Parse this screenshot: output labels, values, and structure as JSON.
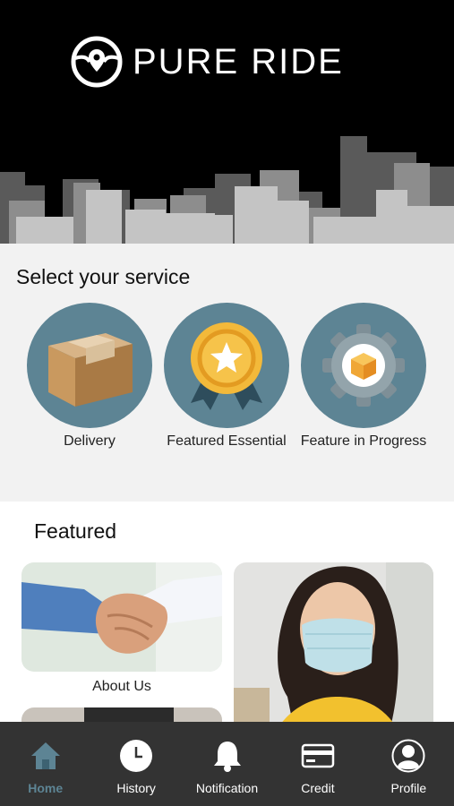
{
  "brand": {
    "name": "PURE RIDE",
    "icon": "steering-wheel-icon"
  },
  "services": {
    "title": "Select your service",
    "items": [
      {
        "label": "Delivery",
        "icon": "package-box-icon"
      },
      {
        "label": "Featured Essential",
        "icon": "award-medal-icon"
      },
      {
        "label": "Feature in Progress",
        "icon": "gear-cube-icon"
      }
    ]
  },
  "featured": {
    "title": "Featured",
    "cards": [
      {
        "label": "About Us",
        "image": "handshake-photo"
      },
      {
        "label": "",
        "image": "masked-woman-photo"
      }
    ]
  },
  "tabbar": {
    "items": [
      {
        "label": "Home",
        "icon": "home-icon",
        "active": true
      },
      {
        "label": "History",
        "icon": "clock-icon",
        "active": false
      },
      {
        "label": "Notification",
        "icon": "bell-icon",
        "active": false
      },
      {
        "label": "Credit",
        "icon": "credit-card-icon",
        "active": false
      },
      {
        "label": "Profile",
        "icon": "user-profile-icon",
        "active": false
      }
    ]
  },
  "colors": {
    "accent": "#5d8494",
    "header_bg": "#000000",
    "tabbar_bg": "#333333",
    "section_bg": "#f2f2f2"
  }
}
